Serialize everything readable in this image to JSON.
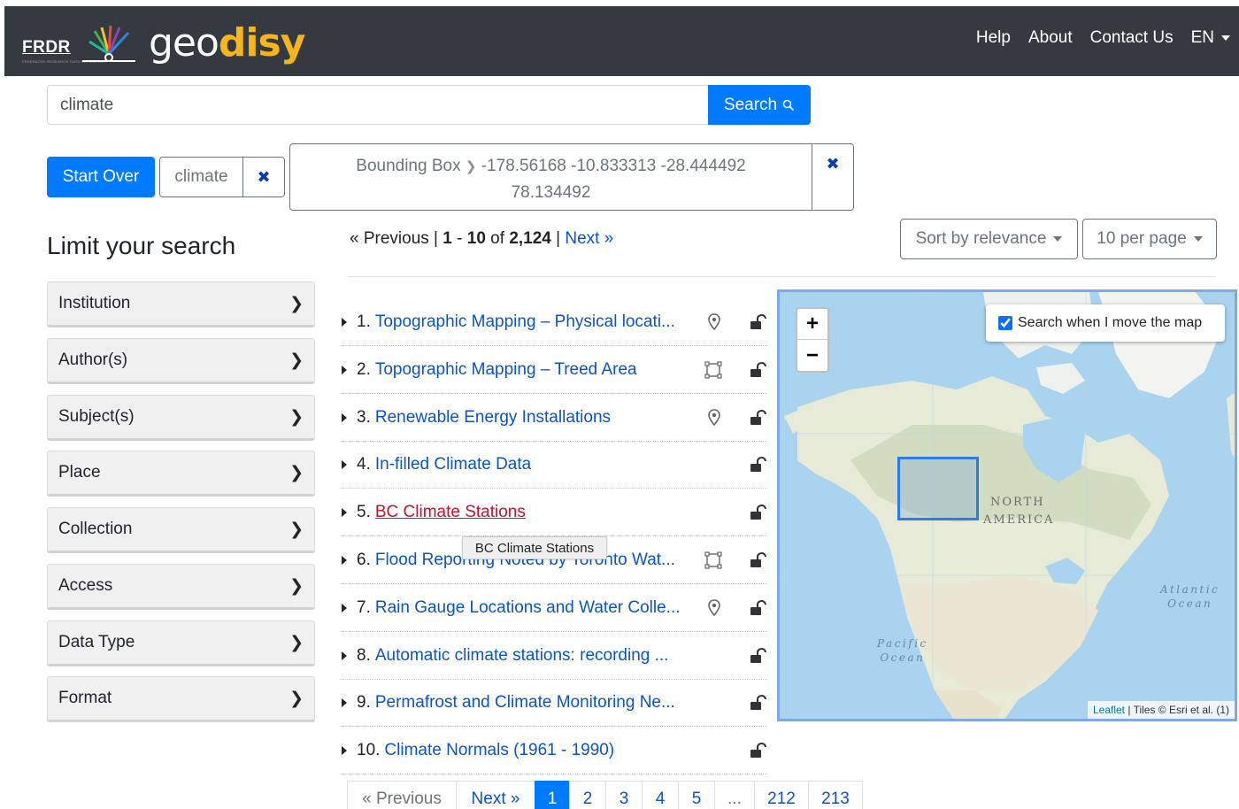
{
  "header": {
    "frdr": "FRDR",
    "frdr_sub": "FEDERATED RESEARCH DATA REPOSITORY",
    "brand_geo": "geo",
    "brand_disy": "disy",
    "nav": {
      "help": "Help",
      "about": "About",
      "contact": "Contact Us",
      "lang": "EN"
    }
  },
  "search": {
    "value": "climate",
    "button_label": "Search"
  },
  "constraints": {
    "start_over": "Start Over",
    "query_chip": "climate",
    "bbox_label": "Bounding Box",
    "bbox_value": "-178.56168 -10.833313 -28.444492 78.134492",
    "remove_glyph": "✖"
  },
  "sidebar": {
    "title": "Limit your search",
    "facets": [
      "Institution",
      "Author(s)",
      "Subject(s)",
      "Place",
      "Collection",
      "Access",
      "Data Type",
      "Format"
    ]
  },
  "pager_top": {
    "previous": "« Previous",
    "range_start": "1",
    "range_end": "10",
    "of": "of",
    "total": "2,124",
    "next": "Next »"
  },
  "sort": {
    "label": "Sort by relevance",
    "per_page": "10 per page"
  },
  "results": [
    {
      "num": "1.",
      "title": "Topographic Mapping – Physical locati...",
      "geo": "point"
    },
    {
      "num": "2.",
      "title": "Topographic Mapping – Treed Area",
      "geo": "polygon"
    },
    {
      "num": "3.",
      "title": "Renewable Energy Installations",
      "geo": "point"
    },
    {
      "num": "4.",
      "title": "In-filled Climate Data",
      "geo": ""
    },
    {
      "num": "5.",
      "title": "BC Climate Stations",
      "geo": "",
      "hover": true
    },
    {
      "num": "6.",
      "title": "Flood Reporting Noted by Toronto Wat...",
      "geo": "polygon"
    },
    {
      "num": "7.",
      "title": "Rain Gauge Locations and Water Colle...",
      "geo": "point"
    },
    {
      "num": "8.",
      "title": "Automatic climate stations: recording ...",
      "geo": ""
    },
    {
      "num": "9.",
      "title": "Permafrost and Climate Monitoring Ne...",
      "geo": ""
    },
    {
      "num": "10.",
      "title": "Climate Normals (1961 - 1990)",
      "geo": ""
    }
  ],
  "tooltip": "BC Climate Stations",
  "map": {
    "search_when_move": "Search when I move the map",
    "zoom_in": "+",
    "zoom_out": "−",
    "north_america": "NORTH",
    "america": "AMERICA",
    "atlantic": "Atlantic",
    "pacific": "Pacific",
    "ocean": "Ocean",
    "attribution_leaflet": "Leaflet",
    "attribution_rest": "| Tiles © Esri et al. (1)"
  },
  "pager_bottom": {
    "previous": "« Previous",
    "next": "Next »",
    "pages": [
      "1",
      "2",
      "3",
      "4",
      "5",
      "...",
      "212",
      "213"
    ],
    "active": "1"
  },
  "colors": {
    "navbar": "#343a40",
    "primary": "#007bff",
    "link": "#0b54c4",
    "brand_yellow": "#f5b51b",
    "hover_link": "#c8102e"
  }
}
